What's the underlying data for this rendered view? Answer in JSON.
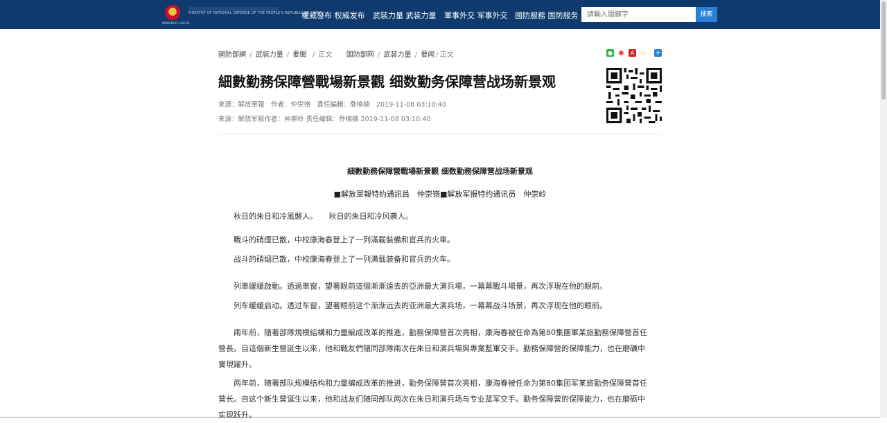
{
  "header": {
    "site_sub": "WWW.MOD.GOV.CN",
    "site_name": "MINISTRY OF NATIONAL DEFENSE OF THE PEOPLE'S REPUBLIC OF CHINA",
    "nav": [
      "權威發布 权威发布",
      "武裝力量 武装力量",
      "軍事外交 军事外交",
      "國防服務 国防服务"
    ],
    "search_placeholder": "請輸入關鍵字",
    "search_button": "搜索"
  },
  "breadcrumb": {
    "trad": [
      "國防部網",
      "武裝力量",
      "要聞"
    ],
    "trad_current": "正文",
    "simp": [
      "国防部网",
      "武装力量",
      "要闻"
    ],
    "simp_current": "正文"
  },
  "share_icons": [
    "wechat-icon",
    "weibo-icon",
    "pdf-icon",
    "favorite-icon",
    "more-share-icon"
  ],
  "article": {
    "title": "細數勤務保障營戰場新景觀 细数勤务保障营战场新景观",
    "meta_trad": "來源：解放軍報　作者：仲崇嶺　責任編輯：喬楠楠　2019-11-08 03:10:40",
    "meta_simp": "来源：解放军报作者：仲崇岭 责任编辑：乔楠楠 2019-11-08 03:10:40",
    "sub_title": "細數勤務保障營戰場新景觀 细数勤務保障营战场新景观",
    "byline": "■解放軍報特約通訊員　仲崇嶺■解放军报特约通讯员　仲崇岭",
    "p1": "秋日的朱日和冷風襲人。　　秋日的朱日和冷风袭人。",
    "p2a": "戰斗的硝煙已散，中校康海春登上了一列滿載裝備和官兵的火車。",
    "p2b": "战斗的硝烟已散，中校康海春登上了一列满载装备和官兵的火车。",
    "p3a": "列車緩緩啟動。透過車窗，望著眼前這個漸漸遠去的亞洲最大演兵場，一幕幕戰斗場景，再次浮現在他的眼前。",
    "p3b": "列车缓缓启动。透过车窗，望著眼前这个渐渐远去的亚洲最大演兵场，一幕幕战斗场景，再次浮现在他的眼前。",
    "p4a": "兩年前，隨著部隊規模結構和力量編成改革的推進，勤務保障營首次亮相，康海春被任命為第80集團軍某旅勤務保障營首任營長。自這個新生營誕生以來，他和戰友們隨同部隊兩次在朱日和演兵場與專業藍軍交手。勤務保障營的保障能力，也在磨礪中實現躍升。",
    "p4b": "两年前，随著部队规模结构和力量编成改革的推进，勤务保障营首次亮相，康海春被任命为第80集团军某旅勤务保障营首任营长。自这个新生营诞生以来，他和战友们随同部队两次在朱日和演兵场与专业蓝军交手。勤务保障营的保障能力，也在磨砺中实现跃升。"
  }
}
